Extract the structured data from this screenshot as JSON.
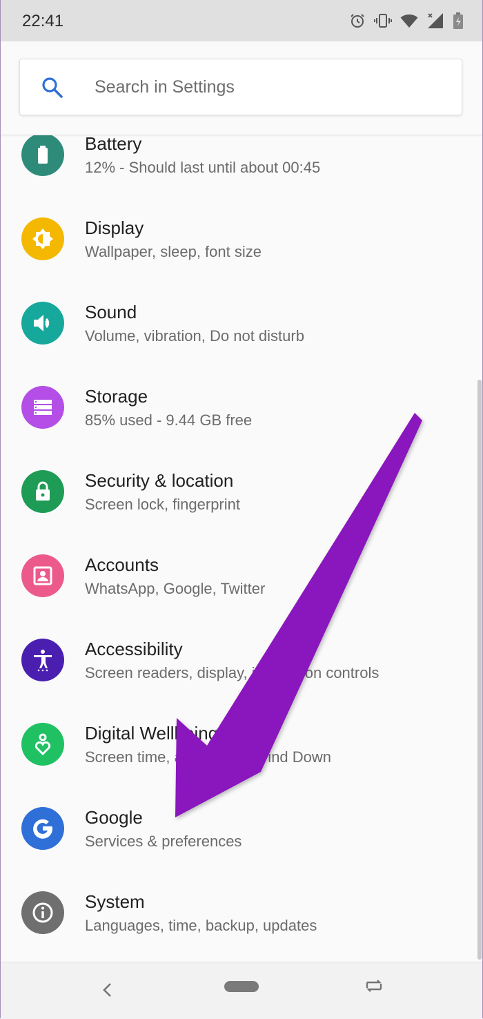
{
  "status_bar": {
    "time": "22:41",
    "icons": [
      "alarm-icon",
      "vibrate-icon",
      "wifi-icon",
      "cell-signal-icon",
      "battery-icon"
    ]
  },
  "search": {
    "placeholder": "Search in Settings",
    "icon": "search-icon"
  },
  "settings": [
    {
      "key": "battery",
      "title": "Battery",
      "subtitle": "12% - Should last until about 00:45",
      "color": "#2e8b7a",
      "icon": "battery-icon"
    },
    {
      "key": "display",
      "title": "Display",
      "subtitle": "Wallpaper, sleep, font size",
      "color": "#f5b800",
      "icon": "brightness-icon"
    },
    {
      "key": "sound",
      "title": "Sound",
      "subtitle": "Volume, vibration, Do not disturb",
      "color": "#17a89c",
      "icon": "volume-icon"
    },
    {
      "key": "storage",
      "title": "Storage",
      "subtitle": "85% used - 9.44 GB free",
      "color": "#b44ee6",
      "icon": "storage-icon"
    },
    {
      "key": "security",
      "title": "Security & location",
      "subtitle": "Screen lock, fingerprint",
      "color": "#1e9b55",
      "icon": "lock-icon"
    },
    {
      "key": "accounts",
      "title": "Accounts",
      "subtitle": "WhatsApp, Google, Twitter",
      "color": "#ec5a8c",
      "icon": "account-icon"
    },
    {
      "key": "accessibility",
      "title": "Accessibility",
      "subtitle": "Screen readers, display, interaction controls",
      "color": "#4a1fb0",
      "icon": "accessibility-icon"
    },
    {
      "key": "wellbeing",
      "title": "Digital Wellbeing",
      "subtitle": "Screen time, app timers, Wind Down",
      "color": "#1fc163",
      "icon": "heart-person-icon"
    },
    {
      "key": "google",
      "title": "Google",
      "subtitle": "Services & preferences",
      "color": "#2f6fd8",
      "icon": "google-icon"
    },
    {
      "key": "system",
      "title": "System",
      "subtitle": "Languages, time, backup, updates",
      "color": "#6f6f6f",
      "icon": "info-icon"
    }
  ],
  "navigation": {
    "buttons": [
      "back-icon",
      "home-icon",
      "rotate-icon"
    ]
  },
  "annotation": {
    "color": "#8a12bd",
    "icon": "arrow-pointer"
  }
}
